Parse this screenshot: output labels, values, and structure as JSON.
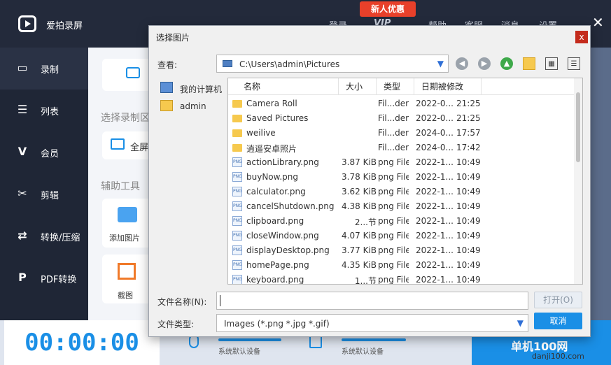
{
  "app": {
    "title": "爱拍录屏",
    "promo": "新人优惠",
    "top_links": [
      "登录",
      "VIP",
      "帮助",
      "客服",
      "消息",
      "设置"
    ],
    "close_glyph": "✕",
    "sidebar": [
      {
        "label": "录制",
        "icon": "▭"
      },
      {
        "label": "列表",
        "icon": "☰"
      },
      {
        "label": "会员",
        "icon": "V"
      },
      {
        "label": "剪辑",
        "icon": "✂"
      },
      {
        "label": "转换/压缩",
        "icon": "⇄"
      },
      {
        "label": "PDF转换",
        "icon": "P"
      }
    ],
    "main": {
      "select_area_label": "选择录制区",
      "fullscreen_label": "全屏",
      "tools_label": "辅助工具",
      "add_image_label": "添加图片",
      "screenshot_label": "截图"
    },
    "timer": "00:00:00",
    "mic_device": "系统默认设备",
    "speaker_device": "系统默认设备",
    "watermark": "单机100网",
    "watermark_url": "danji100.com"
  },
  "dialog": {
    "title": "选择图片",
    "close_glyph": "x",
    "look_in_label": "查看:",
    "look_in_path": "C:\\Users\\admin\\Pictures",
    "places": [
      {
        "label": "我的计算机",
        "icon": "computer-icon"
      },
      {
        "label": "admin",
        "icon": "user-folder-icon"
      }
    ],
    "columns": [
      "名称",
      "大小",
      "类型",
      "日期被修改"
    ],
    "files": [
      {
        "kind": "folder",
        "name": "Camera Roll",
        "size": "",
        "type": "Fil...der",
        "date": "2022-0...",
        "time": "21:25"
      },
      {
        "kind": "folder",
        "name": "Saved Pictures",
        "size": "",
        "type": "Fil...der",
        "date": "2022-0...",
        "time": "21:25"
      },
      {
        "kind": "folder",
        "name": "weilive",
        "size": "",
        "type": "Fil...der",
        "date": "2024-0...",
        "time": "17:57"
      },
      {
        "kind": "folder",
        "name": "逍遥安卓照片",
        "size": "",
        "type": "Fil...der",
        "date": "2024-0...",
        "time": "17:42"
      },
      {
        "kind": "png",
        "name": "actionLibrary.png",
        "size": "3.87 KiB",
        "type": "png File",
        "date": "2022-1...",
        "time": "10:49"
      },
      {
        "kind": "png",
        "name": "buyNow.png",
        "size": "3.78 KiB",
        "type": "png File",
        "date": "2022-1...",
        "time": "10:49"
      },
      {
        "kind": "png",
        "name": "calculator.png",
        "size": "3.62 KiB",
        "type": "png File",
        "date": "2022-1...",
        "time": "10:49"
      },
      {
        "kind": "png",
        "name": "cancelShutdown.png",
        "size": "4.38 KiB",
        "type": "png File",
        "date": "2022-1...",
        "time": "10:49"
      },
      {
        "kind": "png",
        "name": "clipboard.png",
        "size": "2...节",
        "type": "png File",
        "date": "2022-1...",
        "time": "10:49"
      },
      {
        "kind": "png",
        "name": "closeWindow.png",
        "size": "4.07 KiB",
        "type": "png File",
        "date": "2022-1...",
        "time": "10:49"
      },
      {
        "kind": "png",
        "name": "displayDesktop.png",
        "size": "3.77 KiB",
        "type": "png File",
        "date": "2022-1...",
        "time": "10:49"
      },
      {
        "kind": "png",
        "name": "homePage.png",
        "size": "4.35 KiB",
        "type": "png File",
        "date": "2022-1...",
        "time": "10:49"
      },
      {
        "kind": "png",
        "name": "keyboard.png",
        "size": "1...节",
        "type": "png File",
        "date": "2022-1...",
        "time": "10:49"
      }
    ],
    "file_name_label": "文件名称(N):",
    "file_name_value": "",
    "file_type_label": "文件类型:",
    "file_type_value": "Images (*.png *.jpg *.gif)",
    "open_label": "打开(O)",
    "cancel_label": "取消",
    "colors": {
      "accent": "#1a8fe6",
      "close": "#c42b1c"
    }
  }
}
